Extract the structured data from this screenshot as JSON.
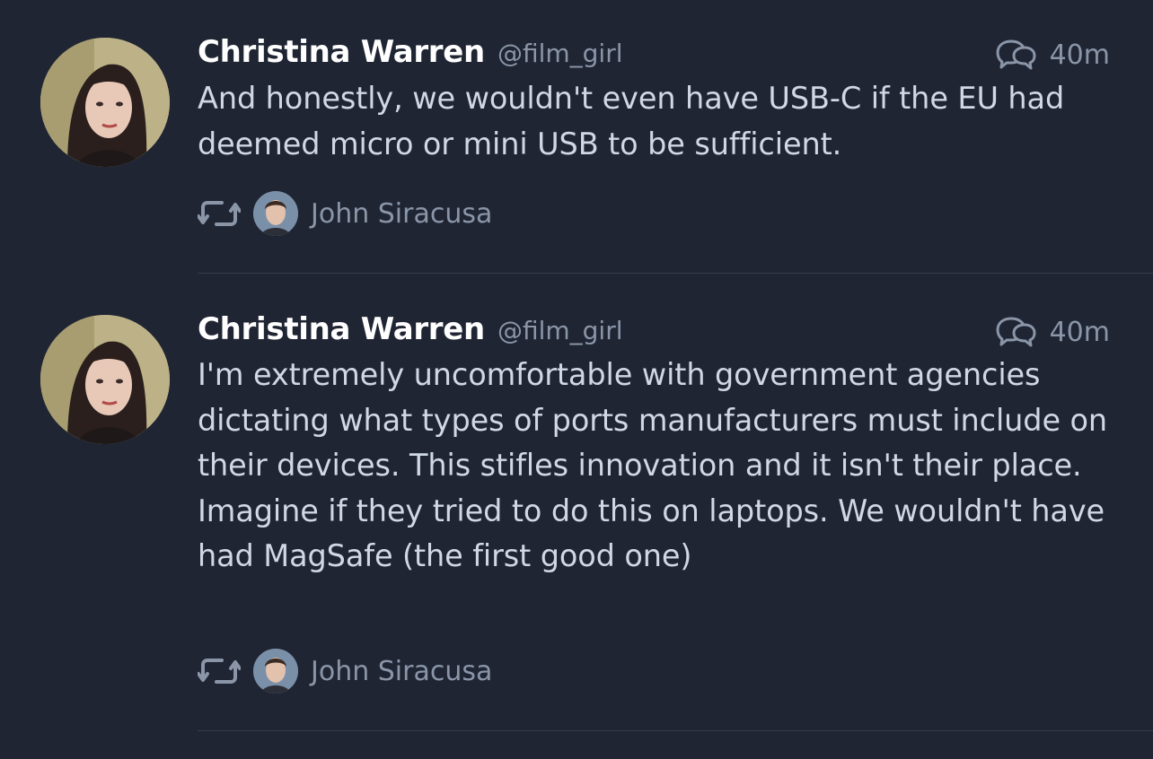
{
  "tweets": [
    {
      "name": "Christina Warren",
      "handle": "@film_girl",
      "time": "40m",
      "text": "And honestly, we wouldn't even have USB-C if the EU had deemed micro or mini USB to be sufficient.",
      "retweeted_by": "John Siracusa",
      "meta_icon": "conversation-icon",
      "retweet_icon": "retweet-icon"
    },
    {
      "name": "Christina Warren",
      "handle": "@film_girl",
      "time": "40m",
      "text": "I'm extremely uncomfortable with government agencies dictating what types of ports manufacturers must include on their devices. This stifles innovation and it isn't their place. Imagine if they tried to do this on laptops. We wouldn't have had MagSafe (the first good one)",
      "retweeted_by": "John Siracusa",
      "meta_icon": "conversation-icon",
      "retweet_icon": "retweet-icon"
    }
  ],
  "colors": {
    "background": "#1f2533",
    "name": "#ffffff",
    "secondary": "#8a96a8",
    "body": "#d0d8e4",
    "divider": "#343c4c"
  }
}
